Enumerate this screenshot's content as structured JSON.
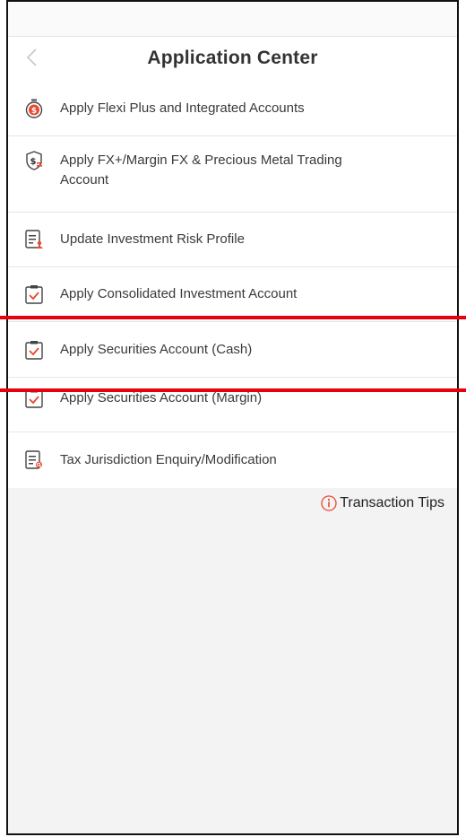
{
  "header": {
    "title": "Application Center"
  },
  "items": [
    {
      "label": "Apply Flexi Plus and Integrated Accounts",
      "icon": "stopwatch-dollar-icon"
    },
    {
      "label": "Apply FX+/Margin FX & Precious Metal Trading Account",
      "icon": "shield-dollar-icon"
    },
    {
      "label": "Update Investment Risk Profile",
      "icon": "profile-document-icon"
    },
    {
      "label": "Apply Consolidated Investment Account",
      "icon": "clipboard-check-icon"
    },
    {
      "label": "Apply Securities Account (Cash)",
      "icon": "clipboard-check-icon"
    },
    {
      "label": "Apply Securities Account (Margin)",
      "icon": "clipboard-check-icon"
    },
    {
      "label": "Tax Jurisdiction Enquiry/Modification",
      "icon": "document-search-icon"
    }
  ],
  "tips": {
    "label": "Transaction Tips"
  },
  "colors": {
    "accent": "#e8492f",
    "highlight": "#e8000b"
  }
}
